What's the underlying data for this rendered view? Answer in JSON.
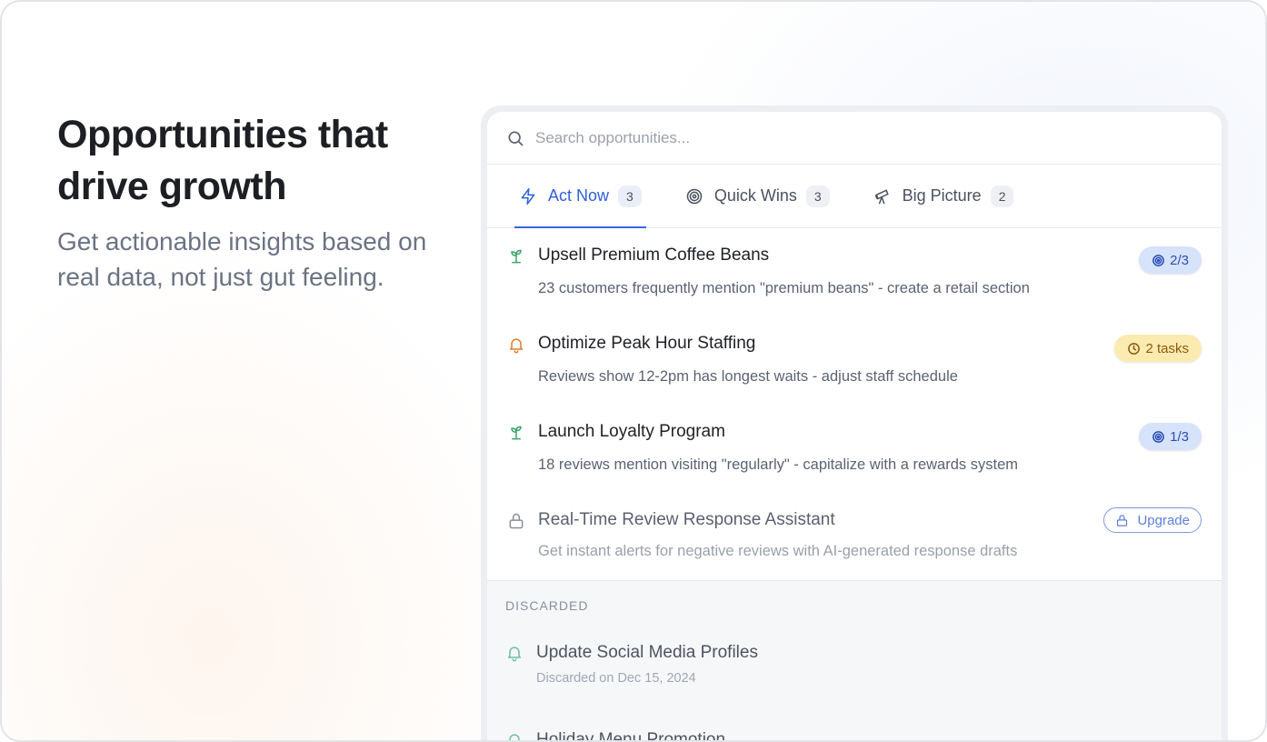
{
  "hero": {
    "title": "Opportunities that drive growth",
    "subtitle": "Get actionable insights based on real data, not just gut feeling."
  },
  "search": {
    "placeholder": "Search opportunities..."
  },
  "tabs": [
    {
      "label": "Act Now",
      "count": "3",
      "icon": "lightning-icon",
      "active": true
    },
    {
      "label": "Quick Wins",
      "count": "3",
      "icon": "target-icon",
      "active": false
    },
    {
      "label": "Big Picture",
      "count": "2",
      "icon": "telescope-icon",
      "active": false
    }
  ],
  "items": [
    {
      "title": "Upsell Premium Coffee Beans",
      "desc": "23 customers frequently mention \"premium beans\" - create a retail section",
      "icon": "sprout-icon",
      "badge": "2/3",
      "badge_icon": "target-icon"
    },
    {
      "title": "Optimize Peak Hour Staffing",
      "desc": "Reviews show 12-2pm has longest waits - adjust staff schedule",
      "icon": "bell-icon",
      "badge": "2 tasks",
      "badge_icon": "clock-icon"
    },
    {
      "title": "Launch Loyalty Program",
      "desc": "18 reviews mention visiting \"regularly\" - capitalize with a rewards system",
      "icon": "sprout-icon",
      "badge": "1/3",
      "badge_icon": "target-icon"
    },
    {
      "title": "Real-Time Review Response Assistant",
      "desc": "Get instant alerts for negative reviews with AI-generated response drafts",
      "icon": "lock-icon",
      "badge": "Upgrade",
      "badge_icon": "lock-icon"
    }
  ],
  "discarded": {
    "label": "DISCARDED",
    "items": [
      {
        "title": "Update Social Media Profiles",
        "sub": "Discarded on Dec 15, 2024",
        "icon": "bell-icon"
      },
      {
        "title": "Holiday Menu Promotion",
        "icon": "bell-icon"
      }
    ]
  },
  "colors": {
    "accent": "#3b67dc",
    "green_icon": "#3aa76d",
    "orange_icon": "#e07b2c",
    "badge_blue": "#d7e3fb",
    "badge_yellow": "#fcebb1"
  }
}
